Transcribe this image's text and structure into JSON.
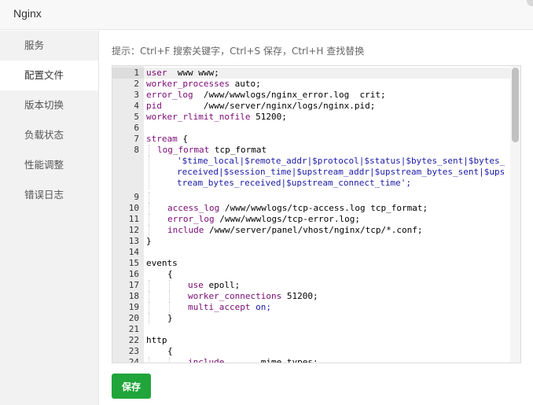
{
  "window": {
    "title": "Nginx"
  },
  "sidebar": {
    "items": [
      {
        "label": "服务"
      },
      {
        "label": "配置文件"
      },
      {
        "label": "版本切换"
      },
      {
        "label": "负载状态"
      },
      {
        "label": "性能调整"
      },
      {
        "label": "错误日志"
      }
    ]
  },
  "main": {
    "hint": "提示：Ctrl+F 搜索关键字，Ctrl+S 保存，Ctrl+H 查找替换",
    "save_label": "保存"
  },
  "editor": {
    "lines": [
      {
        "n": "1",
        "t1": "user",
        "t2": "  www www;"
      },
      {
        "n": "2",
        "t1": "worker_processes",
        "t2": " auto;"
      },
      {
        "n": "3",
        "t1": "error_log",
        "t2": "  /www/wwwlogs/nginx_error.log  crit;"
      },
      {
        "n": "4",
        "t1": "pid",
        "t2": "        /www/server/nginx/logs/nginx.pid;"
      },
      {
        "n": "5",
        "t1": "worker_rlimit_nofile",
        "t2": " 51200;"
      },
      {
        "n": "6",
        "t1": "",
        "t2": ""
      },
      {
        "n": "7",
        "t1": "stream",
        "t2": " {"
      },
      {
        "n": "8",
        "t1": "log_format",
        "t2": " tcp_format"
      },
      {
        "n": "",
        "t1": "'$time_local|$remote_addr|$protocol|$status|$bytes_sent|$bytes_received|$session_time|$upstream_addr|$upstream_bytes_sent|$upstream_bytes_received|$upstream_connect_time';"
      },
      {
        "n": "9",
        "t1": ""
      },
      {
        "n": "10",
        "t1": "access_log",
        "t2": " /www/wwwlogs/tcp-access.log tcp_format;"
      },
      {
        "n": "11",
        "t1": "error_log",
        "t2": " /www/wwwlogs/tcp-error.log;"
      },
      {
        "n": "12",
        "t1": "include",
        "t2": " /www/server/panel/vhost/nginx/tcp/*.conf;"
      },
      {
        "n": "13",
        "t1": "}"
      },
      {
        "n": "14",
        "t1": ""
      },
      {
        "n": "15",
        "t1": "events"
      },
      {
        "n": "16",
        "t1": "{"
      },
      {
        "n": "17",
        "t1": "use",
        "t2": " epoll;"
      },
      {
        "n": "18",
        "t1": "worker_connections",
        "t2": " 51200;"
      },
      {
        "n": "19",
        "t1": "multi_accept",
        "t2": " on;"
      },
      {
        "n": "20",
        "t1": "}"
      },
      {
        "n": "21",
        "t1": ""
      },
      {
        "n": "22",
        "t1": "http"
      },
      {
        "n": "23",
        "t1": "{"
      },
      {
        "n": "24",
        "t1": "include",
        "t2": "       mime.types;"
      }
    ]
  },
  "colors": {
    "accent": "#20a53a",
    "keyword": "#7a0874",
    "string": "#1a1aa6"
  },
  "icons": {
    "close": "close-icon"
  }
}
